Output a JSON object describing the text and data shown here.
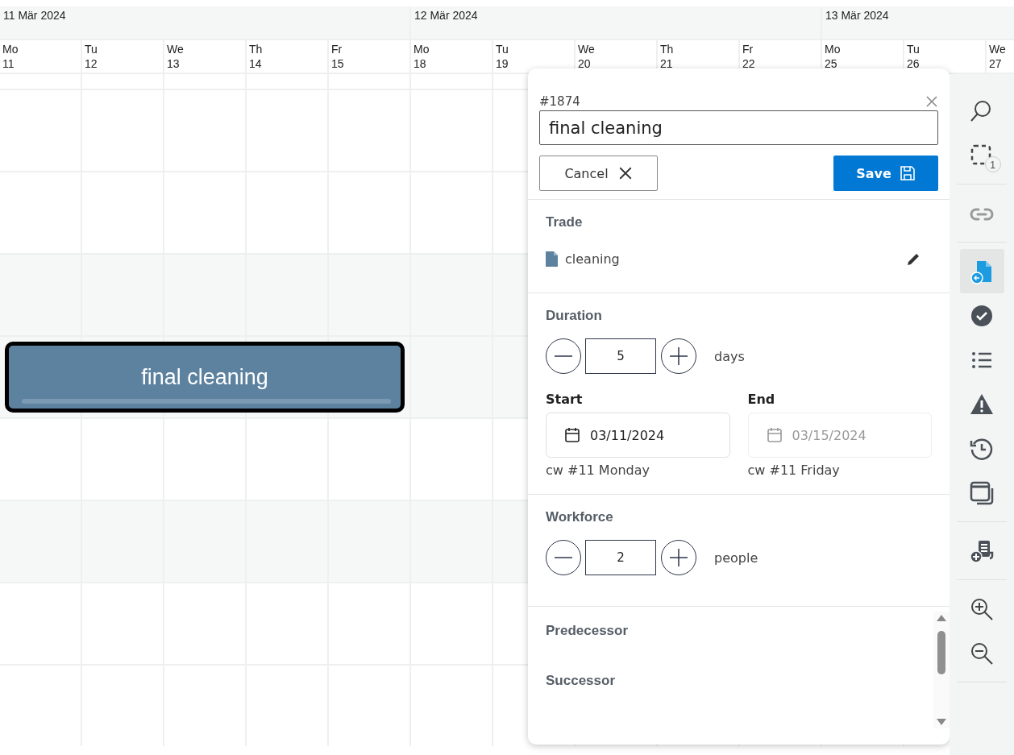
{
  "calendar": {
    "weeks": [
      "11 Mär 2024",
      "12 Mär 2024",
      "13 Mär 2024"
    ],
    "days": [
      {
        "weekday": "Mo",
        "date": "11"
      },
      {
        "weekday": "Tu",
        "date": "12"
      },
      {
        "weekday": "We",
        "date": "13"
      },
      {
        "weekday": "Th",
        "date": "14"
      },
      {
        "weekday": "Fr",
        "date": "15"
      },
      {
        "weekday": "Mo",
        "date": "18"
      },
      {
        "weekday": "Tu",
        "date": "19"
      },
      {
        "weekday": "We",
        "date": "20"
      },
      {
        "weekday": "Th",
        "date": "21"
      },
      {
        "weekday": "Fr",
        "date": "22"
      },
      {
        "weekday": "Mo",
        "date": "25"
      },
      {
        "weekday": "Tu",
        "date": "26"
      },
      {
        "weekday": "We",
        "date": "27"
      }
    ],
    "task": {
      "label": "final cleaning"
    }
  },
  "panel": {
    "number": "#1874",
    "title": "final cleaning",
    "cancel": "Cancel",
    "save": "Save",
    "trade": {
      "heading": "Trade",
      "value": "cleaning"
    },
    "duration": {
      "heading": "Duration",
      "value": "5",
      "unit": "days"
    },
    "dates": [
      {
        "label": "Start",
        "date": "03/11/2024",
        "week": "cw #11 Monday",
        "disabled": false
      },
      {
        "label": "End",
        "date": "03/15/2024",
        "week": "cw #11 Friday",
        "disabled": true
      }
    ],
    "workforce": {
      "heading": "Workforce",
      "value": "2",
      "unit": "people"
    },
    "relations": [
      "Predecessor",
      "Successor"
    ]
  },
  "toolbar": {
    "groups": [
      [
        {
          "kind": "search",
          "selected": false,
          "disabled": false
        },
        {
          "kind": "selection",
          "badge": "1",
          "selected": false,
          "disabled": false
        }
      ],
      [
        {
          "kind": "link",
          "selected": false,
          "disabled": true
        }
      ],
      [
        {
          "kind": "import",
          "selected": true,
          "disabled": false
        },
        {
          "kind": "check",
          "selected": false,
          "disabled": false
        },
        {
          "kind": "list",
          "selected": false,
          "disabled": false
        },
        {
          "kind": "warning",
          "selected": false,
          "disabled": false
        },
        {
          "kind": "history",
          "selected": false,
          "disabled": false
        },
        {
          "kind": "windows",
          "selected": false,
          "disabled": false
        }
      ],
      [
        {
          "kind": "report",
          "selected": false,
          "disabled": false
        }
      ],
      [
        {
          "kind": "zoomin",
          "selected": false,
          "disabled": false
        },
        {
          "kind": "zoomout",
          "selected": false,
          "disabled": false
        }
      ]
    ]
  }
}
